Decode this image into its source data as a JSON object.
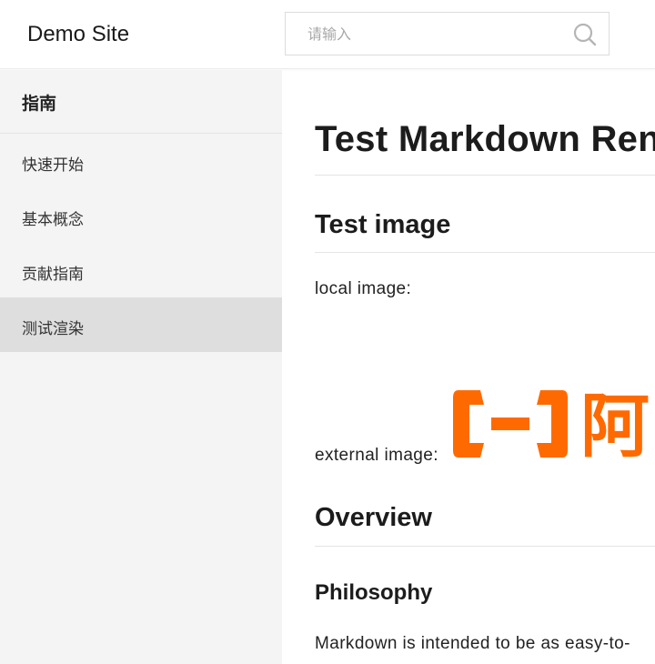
{
  "header": {
    "site_title": "Demo Site",
    "search": {
      "placeholder": "请输入"
    }
  },
  "sidebar": {
    "group_title": "指南",
    "items": [
      {
        "label": "快速开始",
        "active": false
      },
      {
        "label": "基本概念",
        "active": false
      },
      {
        "label": "贡献指南",
        "active": false
      },
      {
        "label": "测试渲染",
        "active": true
      }
    ]
  },
  "content": {
    "title": "Test Markdown Ren",
    "sections": {
      "test_image": "Test image",
      "local_image_label": "local image:",
      "external_image_label": "external image:",
      "external_image_text": "阿",
      "overview": "Overview",
      "philosophy": "Philosophy",
      "philosophy_text": "Markdown is intended to be as easy-to-"
    }
  },
  "colors": {
    "accent_orange": "#ff6a00",
    "sidebar_bg": "#f4f4f4",
    "sidebar_active_bg": "#dedede"
  }
}
